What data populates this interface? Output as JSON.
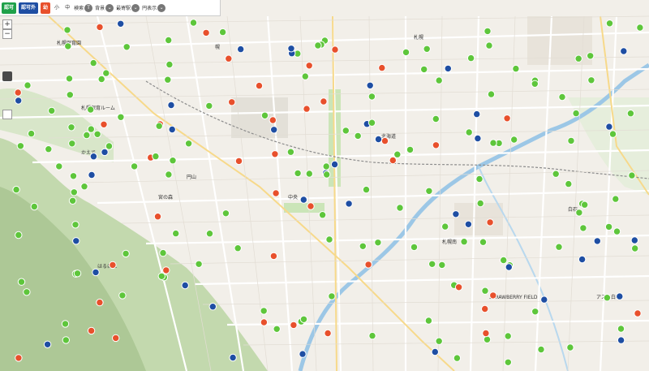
{
  "toolbar": {
    "btn_in": "認可",
    "btn_out": "認可外",
    "btn_red": "幼",
    "size_small": "小",
    "size_mid": "中",
    "search": "検索",
    "background": "背景",
    "nearest_station": "最寄駅",
    "circle_display": "円表示"
  },
  "map_labels": {
    "area1": "STRAWBERRY FIELD",
    "s1": "札幌",
    "s2": "幌",
    "s3": "北海道",
    "s4": "中央",
    "s5": "札幌保育ルーム",
    "s6": "札幌南",
    "s7": "白石",
    "s8": "札幌保育園",
    "s9": "円山",
    "s10": "宮の森",
    "s11": "かえで",
    "s12": "はるにれ",
    "s13": "アスク白石"
  },
  "colors": {
    "green": "#5ec63b",
    "red": "#e8502c",
    "blue": "#1e4ea3",
    "road": "#ffffff",
    "river": "#9cc7e6",
    "park": "#cbe5b8",
    "mountain": "#b9d3a5"
  },
  "icons": {
    "marker_green": "green-childcare-marker-icon",
    "marker_red": "red-kindergarten-marker-icon",
    "marker_blue": "blue-unlicensed-marker-icon"
  }
}
